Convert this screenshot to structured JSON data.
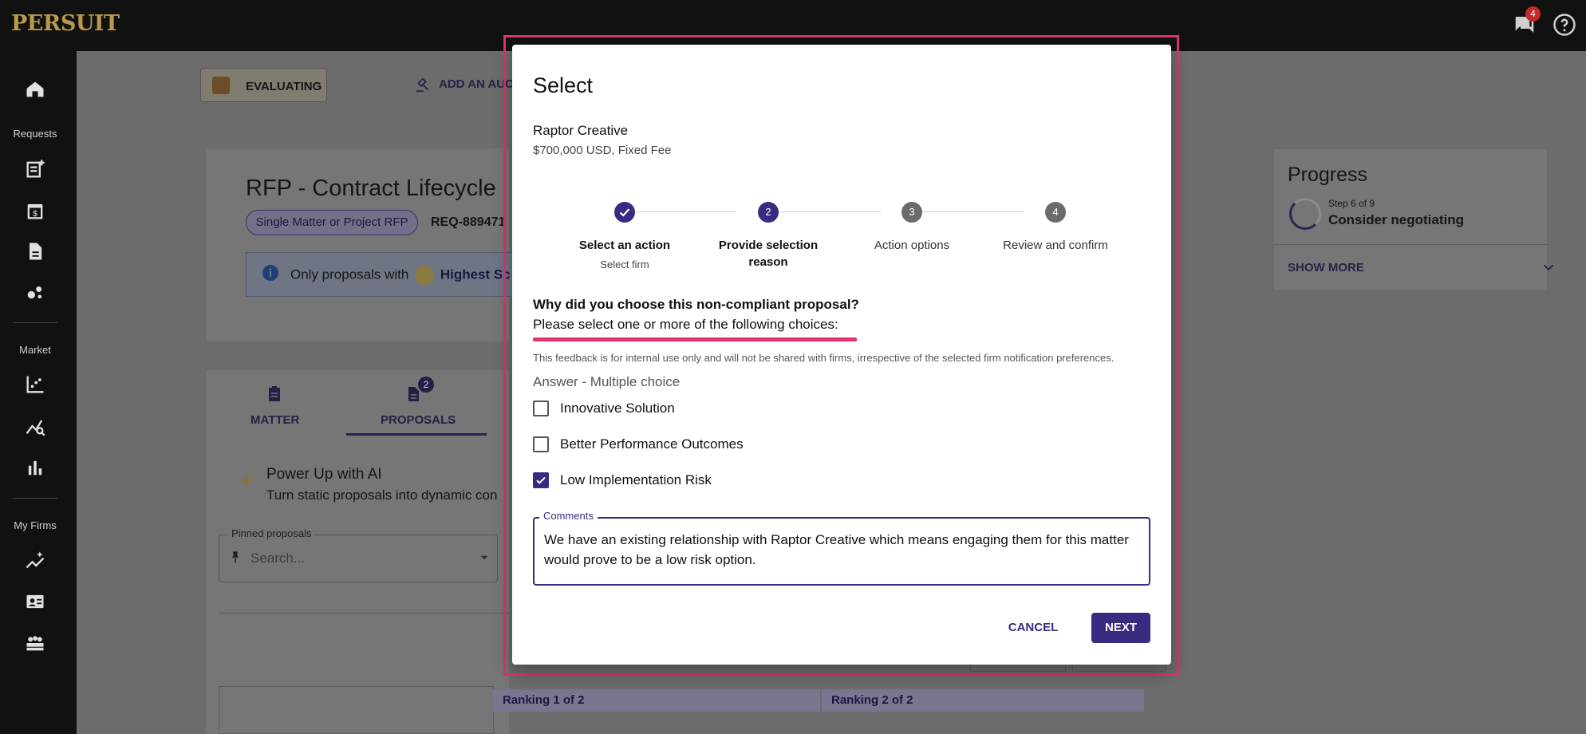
{
  "app": {
    "logo": "PERSUIT",
    "message_count": "4"
  },
  "sidebar": {
    "sections": [
      "Requests",
      "Market",
      "My Firms"
    ]
  },
  "background": {
    "status_button": "EVALUATING",
    "add_auction": "ADD AN AUC",
    "rfp_title": "RFP - Contract Lifecycle",
    "chip": "Single Matter or Project RFP",
    "request_id": "REQ-889471",
    "info_text": "Only proposals with",
    "info_bold": "Highest Sc",
    "tabs": [
      {
        "label": "MATTER"
      },
      {
        "label": "PROPOSALS",
        "count": "2"
      }
    ],
    "power_up_title": "Power Up with AI",
    "power_up_sub": "Turn static proposals into dynamic con",
    "pinned_label": "Pinned proposals",
    "pinned_placeholder": "Search...",
    "ranking_1": "Ranking 1 of 2",
    "ranking_2": "Ranking 2 of 2"
  },
  "progress": {
    "title": "Progress",
    "step_text": "Step 6 of 9",
    "step_name": "Consider negotiating",
    "show_more": "SHOW MORE"
  },
  "dialog": {
    "title": "Select",
    "firm_name": "Raptor Creative",
    "price": "$700,000 USD, Fixed Fee",
    "steps": [
      {
        "num": "",
        "label": "Select an action",
        "sub": "Select firm",
        "state": "done"
      },
      {
        "num": "2",
        "label": "Provide selection reason",
        "sub": "",
        "state": "active"
      },
      {
        "num": "3",
        "label": "Action options",
        "sub": "",
        "state": "pending"
      },
      {
        "num": "4",
        "label": "Review and confirm",
        "sub": "",
        "state": "pending"
      }
    ],
    "question": "Why did you choose this non-compliant proposal?",
    "instruction": "Please select one or more of the following choices:",
    "feedback_note": "This feedback is for internal use only and will not be shared with firms, irrespective of the selected firm notification preferences.",
    "answer_label": "Answer - Multiple choice",
    "options": [
      {
        "label": "Innovative Solution",
        "checked": false
      },
      {
        "label": "Better Performance Outcomes",
        "checked": false
      },
      {
        "label": "Low Implementation Risk",
        "checked": true
      }
    ],
    "comments_label": "Comments",
    "comments_value": "We have an existing relationship with Raptor Creative which means engaging them for this matter would prove to be a low risk option.",
    "cancel_label": "CANCEL",
    "next_label": "NEXT"
  },
  "colors": {
    "accent": "#3b2a82",
    "highlight": "#e0336f",
    "logo": "#b89a4a"
  }
}
